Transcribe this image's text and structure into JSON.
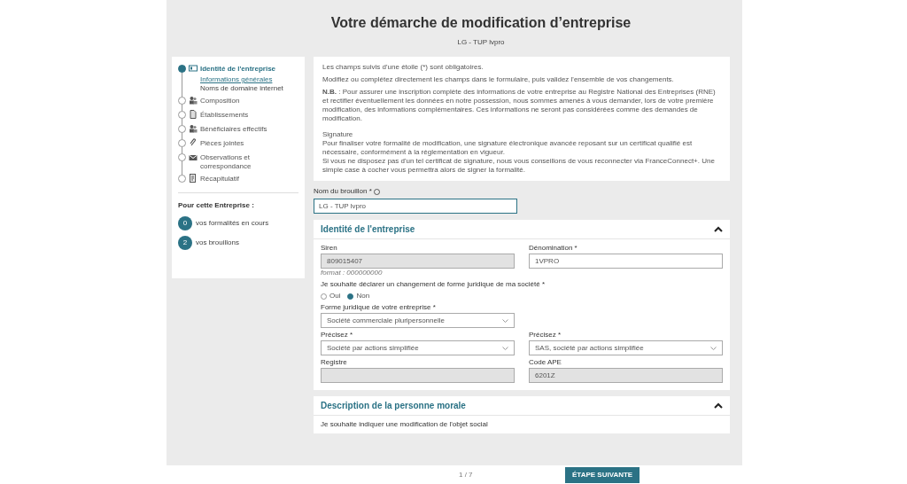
{
  "header": {
    "title": "Votre démarche de modification d’entreprise",
    "subtitle": "LG - TUP lvpro"
  },
  "steps": [
    {
      "label": "Identité de l'entreprise",
      "selected": true,
      "children": [
        {
          "label": "Informations générales",
          "selected": true
        },
        {
          "label": "Noms de domaine internet",
          "selected": false
        }
      ]
    },
    {
      "label": "Composition",
      "selected": false
    },
    {
      "label": "Établissements",
      "selected": false
    },
    {
      "label": "Bénéficiaires effectifs",
      "selected": false
    },
    {
      "label": "Pièces jointes",
      "selected": false
    },
    {
      "label": "Observations et correspondance",
      "selected": false
    },
    {
      "label": "Récapitulatif",
      "selected": false
    }
  ],
  "company_panel": {
    "title": "Pour cette Entreprise :",
    "items": [
      {
        "count": "0",
        "label": "vos formalités en cours"
      },
      {
        "count": "2",
        "label": "vos brouillons"
      }
    ]
  },
  "info": {
    "paragraphs": [
      "Les champs suivis d'une étoile (*) sont obligatoires.",
      "Modifiez ou complétez directement les champs dans le formulaire, puis validez l'ensemble de vos changements.",
      "**N.B.** : Pour assurer une inscription complète des informations de votre entreprise au Registre National des Entreprises (RNE) et rectifier éventuellement les données en notre possession, nous sommes amenés à vous demander, lors de votre première modification, des informations complémentaires. Ces informations ne seront pas considérées comme des demandes de modification."
    ],
    "signature_lines": [
      "Signature",
      "Pour finaliser votre formalité de modification, une signature électronique avancée reposant sur un certificat qualifié est nécessaire, conformément à la réglementation en vigueur.",
      "Si vous ne disposez pas d'un tel certificat de signature, nous vous conseillons de vous reconnecter via FranceConnect+. Une simple case à cocher vous permettra alors de signer la formalité."
    ]
  },
  "draft_name": {
    "label": "Nom du brouillon *",
    "value": "LG - TUP lvpro"
  },
  "identity_section": {
    "title": "Identité de l'entreprise",
    "expanded": true,
    "siren": {
      "label": "Siren",
      "value": "809015407",
      "disabled": true,
      "hint": "format : 000000000"
    },
    "denomination": {
      "label": "Dénomination *",
      "value": "1VPRO",
      "disabled": false
    },
    "legal_change": {
      "question": "Je souhaite déclarer un changement de forme juridique de ma société *",
      "options": [
        {
          "label": "Oui",
          "selected": false
        },
        {
          "label": "Non",
          "selected": true
        }
      ]
    },
    "legal_form": {
      "label": "Forme juridique de votre entreprise *",
      "value": "Société commerciale pluripersonnelle"
    },
    "precisez_1": {
      "label": "Précisez *",
      "value": "Société par actions simplifiée"
    },
    "precisez_2": {
      "label": "Précisez *",
      "value": "SAS, société par actions simplifiée"
    },
    "registre": {
      "label": "Registre",
      "disabled": true
    },
    "ape": {
      "label": "Code APE",
      "value": "6201Z",
      "disabled": true
    }
  },
  "description_section": {
    "title": "Description de la personne morale",
    "expanded": true,
    "question": "Je souhaite indiquer une modification de l'objet social"
  },
  "footer": {
    "page": "1 / 7",
    "next_button": "ÉTAPE SUIVANTE"
  }
}
